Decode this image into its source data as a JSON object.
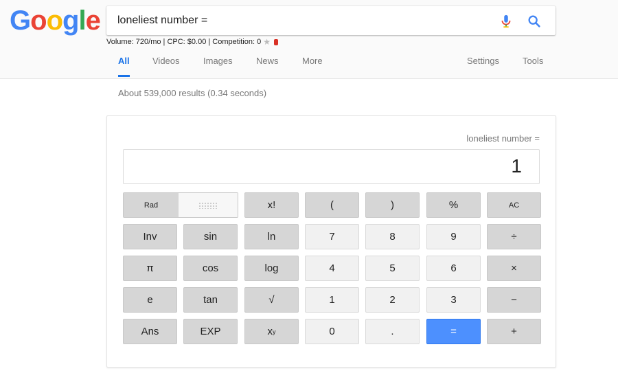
{
  "logo": {
    "letters": [
      "G",
      "o",
      "o",
      "g",
      "l",
      "e"
    ],
    "colors": [
      "#4285f4",
      "#ea4335",
      "#fbbc05",
      "#4285f4",
      "#34a853",
      "#ea4335"
    ]
  },
  "search": {
    "value": "loneliest number ="
  },
  "icons": {
    "mic": "mic-icon",
    "search": "search-icon",
    "star": "star-icon",
    "db": "database-icon"
  },
  "seo": {
    "text": "Volume: 720/mo | CPC: $0.00 | Competition: 0"
  },
  "tabs": {
    "all": "All",
    "videos": "Videos",
    "images": "Images",
    "news": "News",
    "more": "More",
    "settings": "Settings",
    "tools": "Tools"
  },
  "results": {
    "count": "About 539,000 results (0.34 seconds)"
  },
  "calculator": {
    "history": "loneliest number =",
    "display": "1",
    "rad": "Rad",
    "keys": {
      "fact": "x!",
      "lparen": "(",
      "rparen": ")",
      "percent": "%",
      "ac": "AC",
      "inv": "Inv",
      "sin": "sin",
      "ln": "ln",
      "d7": "7",
      "d8": "8",
      "d9": "9",
      "div": "÷",
      "pi": "π",
      "cos": "cos",
      "log": "log",
      "d4": "4",
      "d5": "5",
      "d6": "6",
      "mul": "×",
      "e": "e",
      "tan": "tan",
      "sqrt": "√",
      "d1": "1",
      "d2": "2",
      "d3": "3",
      "sub": "−",
      "ans": "Ans",
      "exp": "EXP",
      "pow_base": "x",
      "pow_exp": "y",
      "d0": "0",
      "dot": ".",
      "eq": "=",
      "add": "+"
    }
  },
  "accent": "#1a73e8"
}
